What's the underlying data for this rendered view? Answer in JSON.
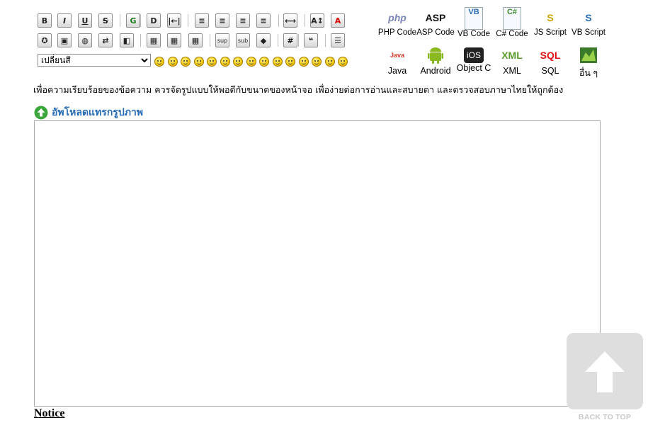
{
  "toolbar": {
    "row1": [
      {
        "name": "bold-button",
        "glyph": "B"
      },
      {
        "name": "italic-button",
        "glyph": "I"
      },
      {
        "name": "underline-button",
        "glyph": "U"
      },
      {
        "name": "strikethrough-button",
        "glyph": "S"
      },
      {
        "name": "glow-button",
        "glyph": "G"
      },
      {
        "name": "shadow-button",
        "glyph": "D"
      },
      {
        "name": "indent-button",
        "glyph": "|←|"
      },
      {
        "name": "align-justify-button",
        "glyph": "≡"
      },
      {
        "name": "align-left-button",
        "glyph": "≡"
      },
      {
        "name": "align-center-button",
        "glyph": "≡"
      },
      {
        "name": "align-right-button",
        "glyph": "≡"
      },
      {
        "name": "horizontal-rule-button",
        "glyph": "⟷"
      },
      {
        "name": "font-size-button",
        "glyph": "A↕"
      },
      {
        "name": "font-color-button",
        "glyph": "A"
      }
    ],
    "row2": [
      {
        "name": "flash-button",
        "glyph": "✪"
      },
      {
        "name": "image-button",
        "glyph": "▣"
      },
      {
        "name": "hyperlink-button",
        "glyph": "◍"
      },
      {
        "name": "move-button",
        "glyph": "⇄"
      },
      {
        "name": "ftp-button",
        "glyph": "◧"
      },
      {
        "name": "table-button",
        "glyph": "▦"
      },
      {
        "name": "table-insert-button",
        "glyph": "▦"
      },
      {
        "name": "table-grid-button",
        "glyph": "▦"
      },
      {
        "name": "superscript-button",
        "glyph": "sup"
      },
      {
        "name": "subscript-button",
        "glyph": "sub"
      },
      {
        "name": "teletype-button",
        "glyph": "◆"
      },
      {
        "name": "code-button",
        "glyph": "#"
      },
      {
        "name": "quote-button",
        "glyph": "❝"
      },
      {
        "name": "list-button",
        "glyph": "☰"
      }
    ],
    "color_select_value": "เปลี่ยนสี",
    "smiley_count": 15
  },
  "code_languages": [
    {
      "name": "php",
      "label": "PHP Code",
      "icon_text": "php",
      "color": "#7a86b8"
    },
    {
      "name": "asp",
      "label": "ASP Code",
      "icon_text": "ASP",
      "color": "#111111"
    },
    {
      "name": "vb",
      "label": "VB Code",
      "icon_text": "VB",
      "color": "#2a6db5"
    },
    {
      "name": "csharp",
      "label": "C# Code",
      "icon_text": "C#",
      "color": "#3a8a2a"
    },
    {
      "name": "js",
      "label": "JS Script",
      "icon_text": "S",
      "color": "#c9a400"
    },
    {
      "name": "vbscript",
      "label": "VB Script",
      "icon_text": "S",
      "color": "#2a6db5"
    },
    {
      "name": "java",
      "label": "Java",
      "icon_text": "Java",
      "color": "#d33a2a"
    },
    {
      "name": "android",
      "label": "Android",
      "icon_text": "",
      "color": "#8ab820"
    },
    {
      "name": "objc",
      "label": "Object C",
      "icon_text": "iOS",
      "color": "#222222"
    },
    {
      "name": "xml",
      "label": "XML",
      "icon_text": "XML",
      "color": "#5a9a2a"
    },
    {
      "name": "sql",
      "label": "SQL",
      "icon_text": "SQL",
      "color": "#e01010"
    },
    {
      "name": "other",
      "label": "อื่น ๆ",
      "icon_text": "",
      "color": "#4a9a3a"
    }
  ],
  "instruction_text": "เพื่อความเรียบร้อยของข้อความ ควรจัดรูปแบบให้พอดีกับขนาดของหน้าจอ เพื่อง่ายต่อการอ่านและสบายตา และตรวจสอบภาษาไทยให้ถูกต้อง",
  "upload": {
    "label": "อัพโหลดแทรกรูปภาพ"
  },
  "message": {
    "value": ""
  },
  "notice": {
    "title": "Notice"
  },
  "back_to_top": {
    "label": "BACK TO TOP"
  }
}
